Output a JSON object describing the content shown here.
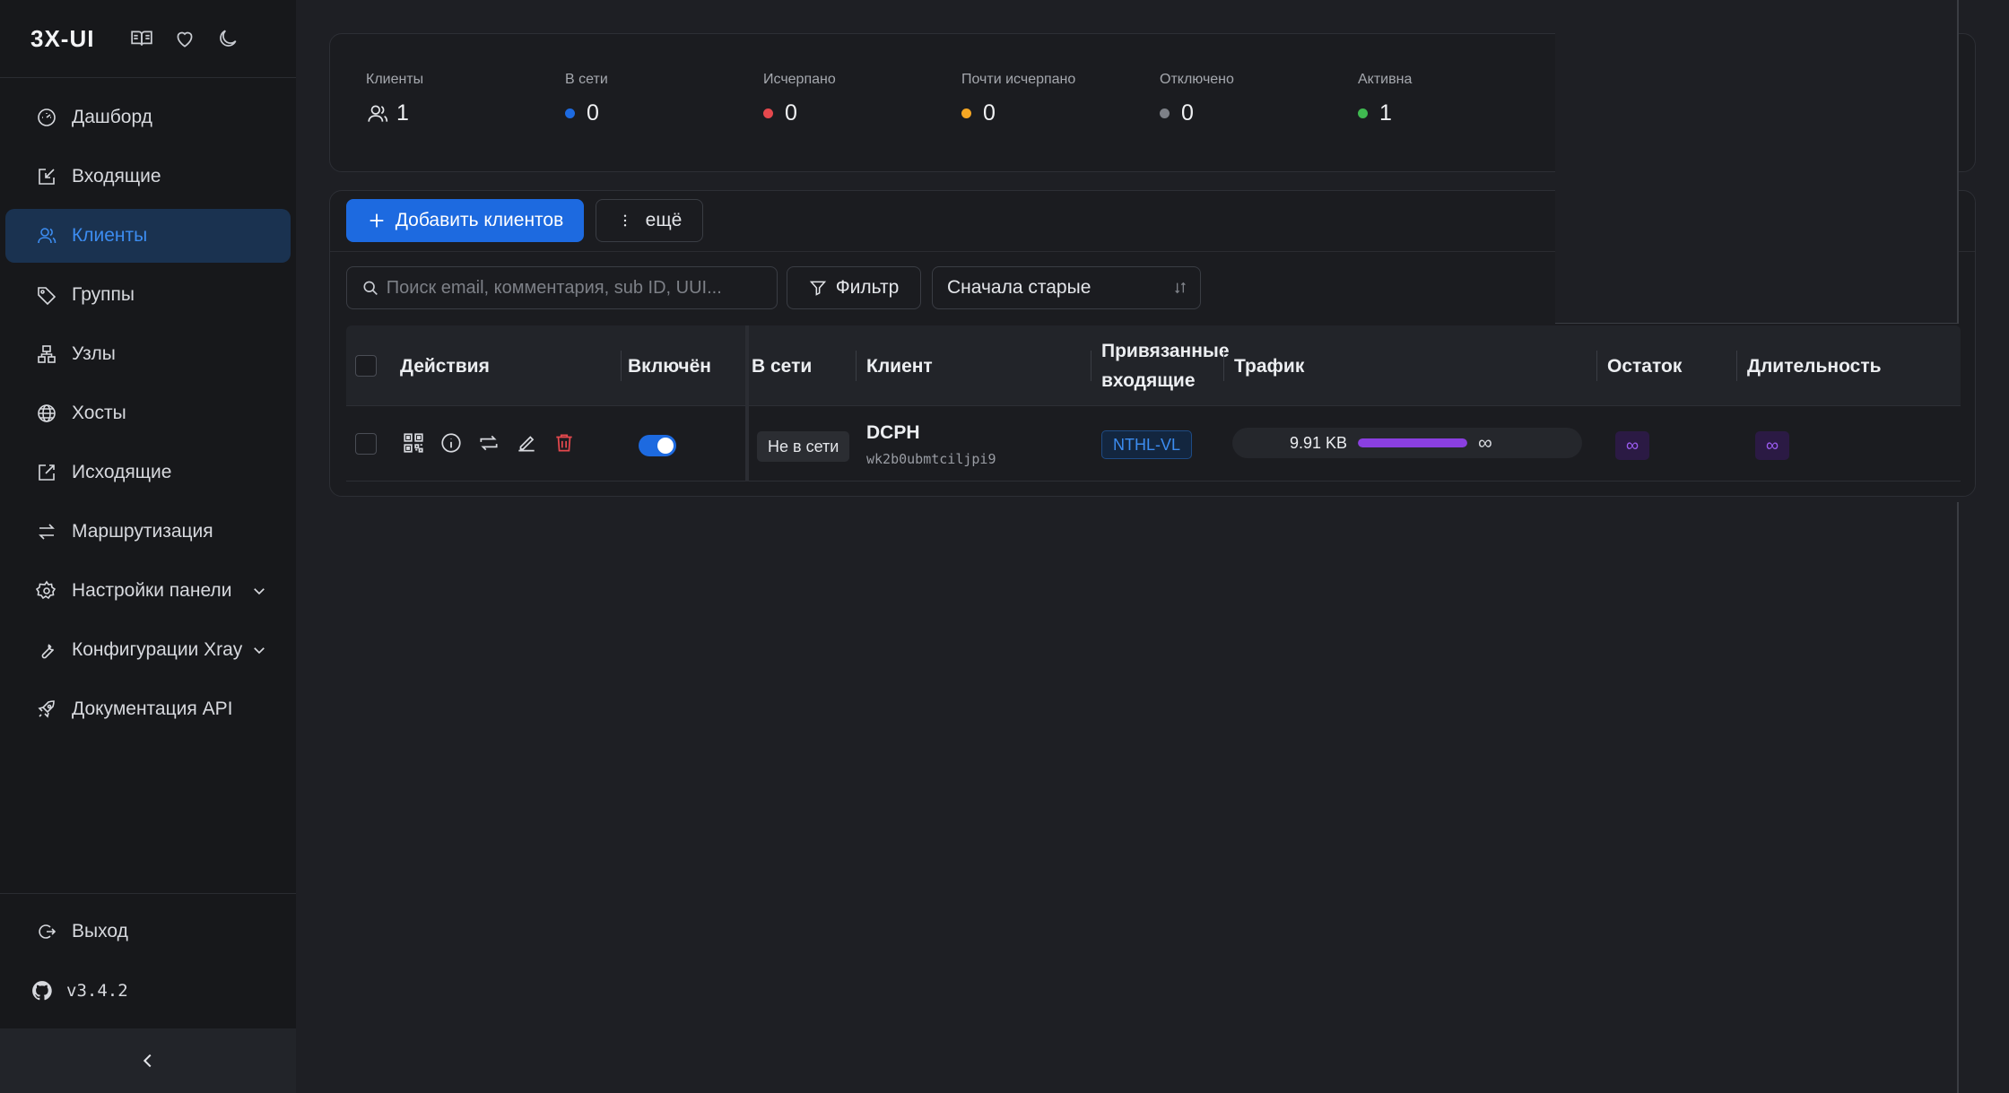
{
  "app": {
    "brand": "3X-UI"
  },
  "brand_icons": [
    "book-icon",
    "heart-icon",
    "moon-icon"
  ],
  "sidebar": {
    "items": [
      {
        "label": "Дашборд",
        "icon": "dashboard-icon"
      },
      {
        "label": "Входящие",
        "icon": "inbound-icon"
      },
      {
        "label": "Клиенты",
        "icon": "users-icon",
        "active": true
      },
      {
        "label": "Группы",
        "icon": "tag-icon"
      },
      {
        "label": "Узлы",
        "icon": "nodes-icon"
      },
      {
        "label": "Хосты",
        "icon": "globe-icon"
      },
      {
        "label": "Исходящие",
        "icon": "outbound-icon"
      },
      {
        "label": "Маршрутизация",
        "icon": "routing-icon"
      },
      {
        "label": "Настройки панели",
        "icon": "gear-icon",
        "expandable": true
      },
      {
        "label": "Конфигурации Xray",
        "icon": "wrench-icon",
        "expandable": true
      },
      {
        "label": "Документация API",
        "icon": "rocket-icon"
      }
    ],
    "logout": "Выход",
    "version": "v3.4.2"
  },
  "stats": {
    "clients": {
      "label": "Клиенты",
      "value": "1"
    },
    "online": {
      "label": "В сети",
      "value": "0",
      "color": "#1d6ae0"
    },
    "depleted": {
      "label": "Исчерпано",
      "value": "0",
      "color": "#e5484d"
    },
    "almost_depleted": {
      "label": "Почти исчерпано",
      "value": "0",
      "color": "#f5a623"
    },
    "disabled": {
      "label": "Отключено",
      "value": "0",
      "color": "#7d8087"
    },
    "active": {
      "label": "Активна",
      "value": "1",
      "color": "#3fb950"
    }
  },
  "toolbar": {
    "add_label": "Добавить клиентов",
    "more_label": "ещё",
    "search_placeholder": "Поиск email, комментария, sub ID, UUI...",
    "filter_label": "Фильтр",
    "sort_value": "Сначала старые"
  },
  "table": {
    "columns": {
      "actions": "Действия",
      "enabled": "Включён",
      "online": "В сети",
      "client": "Клиент",
      "inbounds_line1": "Привязанные",
      "inbounds_line2": "входящие",
      "traffic": "Трафик",
      "remaining": "Остаток",
      "duration": "Длительность"
    },
    "rows": [
      {
        "status": "Не в сети",
        "client": "DCPH",
        "sub_id": "wk2b0ubmtciljpi9",
        "inbound": "NTHL-VL",
        "traffic": "9.91 KB",
        "traffic_fraction": 1.0,
        "traffic_limit": "∞",
        "remaining": "∞",
        "duration": "∞",
        "enabled": true
      }
    ]
  },
  "colors": {
    "accent": "#1d6ae0",
    "traffic_bar": "#8a3fe0",
    "delete": "#e5484d"
  }
}
